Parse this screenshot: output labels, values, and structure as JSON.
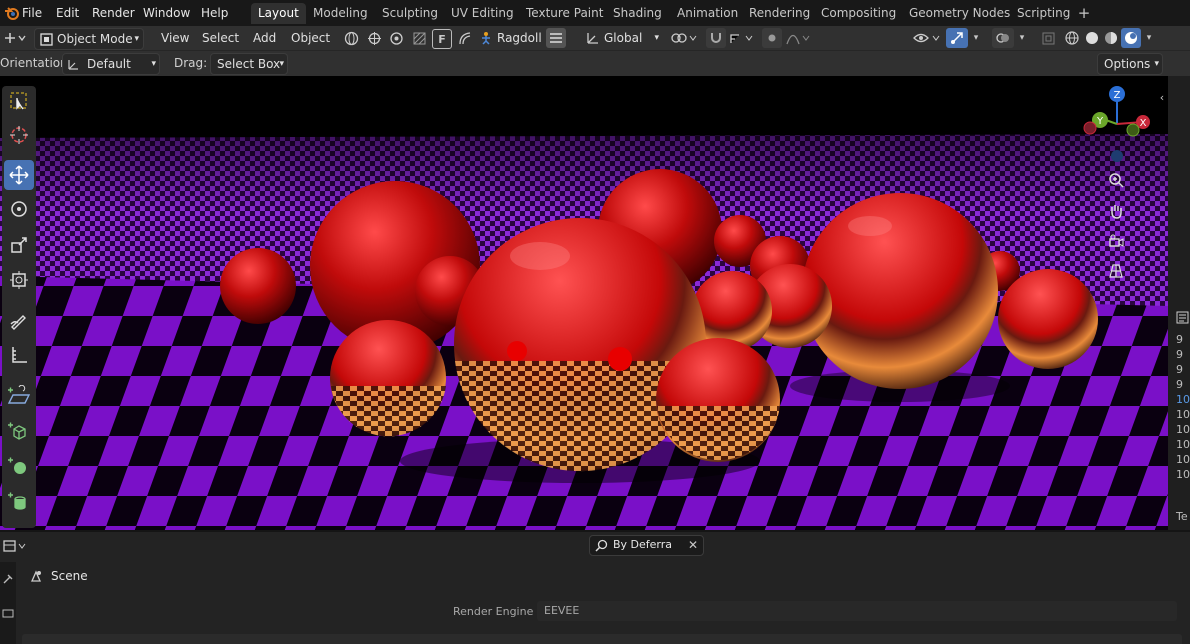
{
  "menus": [
    "File",
    "Edit",
    "Render",
    "Window",
    "Help"
  ],
  "workspaces": [
    "Layout",
    "Modeling",
    "Sculpting",
    "UV Editing",
    "Texture Paint",
    "Shading",
    "Animation",
    "Rendering",
    "Compositing",
    "Geometry Nodes",
    "Scripting"
  ],
  "header": {
    "mode": "Object Mode",
    "view": "View",
    "select": "Select",
    "add": "Add",
    "object": "Object",
    "f_key": "F",
    "ragdoll": "Ragdoll",
    "transform_orientation": "Global"
  },
  "toolsettings": {
    "orientation_label": "Orientation:",
    "orientation_value": "Default",
    "drag_label": "Drag:",
    "drag_value": "Select Box",
    "options": "Options"
  },
  "gizmo": {
    "z": "Z",
    "y": "Y",
    "x": "X"
  },
  "right_strip": {
    "lines": [
      "9",
      "9",
      "9",
      "9",
      "10",
      "10",
      "10",
      "10",
      "10",
      "10",
      "Te"
    ],
    "highlight_index": 4
  },
  "search": {
    "value": "By Deferra"
  },
  "properties": {
    "scene_label": "Scene",
    "render_engine_label": "Render Engine",
    "render_engine_value": "EEVEE"
  },
  "colors": {
    "accent": "#4772b3",
    "floor_purple": "#7a10c8",
    "sphere_red": "#c01010"
  }
}
